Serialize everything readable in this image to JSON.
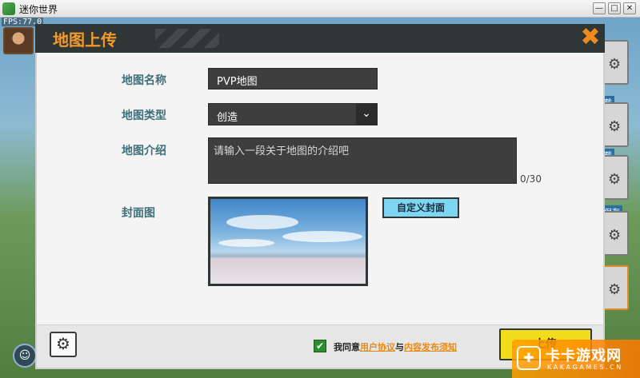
{
  "window": {
    "title": "迷你世界",
    "minimize": "—",
    "maximize": "□",
    "close": "✕"
  },
  "hud": {
    "fps": "FPS:77.0"
  },
  "side_tags": [
    "载",
    "载",
    "保存"
  ],
  "dialog": {
    "title": "地图上传",
    "close_glyph": "✖",
    "fields": {
      "name_label": "地图名称",
      "name_value": "PVP地图",
      "type_label": "地图类型",
      "type_value": "创造",
      "intro_label": "地图介绍",
      "intro_placeholder": "请输入一段关于地图的介绍吧",
      "intro_counter": "0/30",
      "cover_label": "封面图",
      "cover_button": "自定义封面"
    },
    "footer": {
      "agree_prefix": "我同意",
      "user_agreement": "用户协议",
      "and": "与",
      "publish_notice": "内容发布须知",
      "upload_button": "上传"
    }
  },
  "watermark": {
    "text": "卡卡游戏网",
    "sub": "K A K A G A M E S . C N"
  },
  "icons": {
    "settings": "gear-icon",
    "dropdown": "chevron-down-icon",
    "close": "close-icon",
    "check": "checkbox-checked-icon"
  },
  "colors": {
    "accent": "#f39a2b",
    "header": "#2f3636",
    "upload": "#f2dc1c",
    "cover_button": "#7fd6f2",
    "label": "#3f6f7a"
  }
}
